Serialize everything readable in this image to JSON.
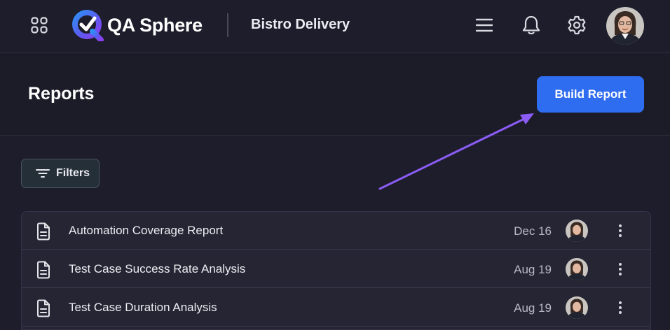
{
  "header": {
    "app_name": "QA Sphere",
    "project_name": "Bistro Delivery",
    "icons": [
      "apps-grid-icon",
      "menu-icon",
      "bell-icon",
      "gear-icon"
    ]
  },
  "page": {
    "title": "Reports",
    "build_report_label": "Build Report",
    "filters_label": "Filters"
  },
  "colors": {
    "accent": "#2f6df0",
    "annotation_arrow": "#8b5cf6",
    "background": "#1e1d2b"
  },
  "reports": [
    {
      "title": "Automation Coverage Report",
      "date": "Dec 16"
    },
    {
      "title": "Test Case Success Rate Analysis",
      "date": "Aug 19"
    },
    {
      "title": "Test Case Duration Analysis",
      "date": "Aug 19"
    }
  ]
}
